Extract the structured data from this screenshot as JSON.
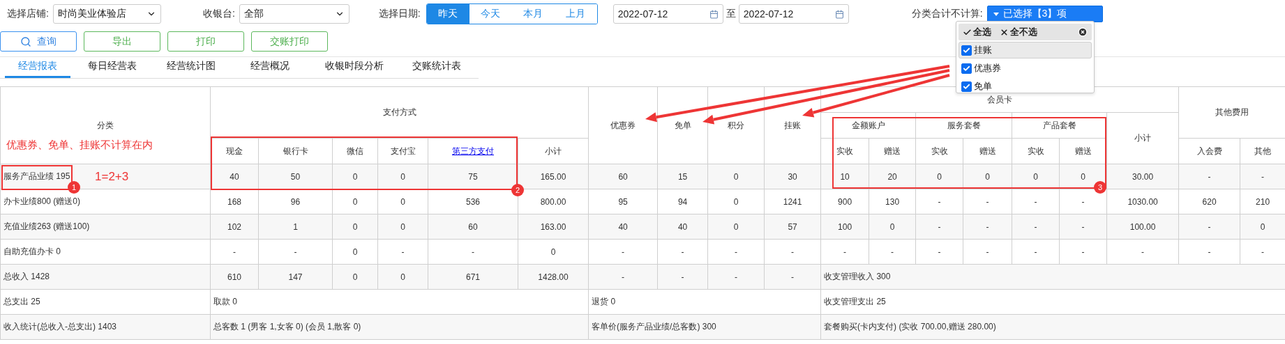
{
  "filters": {
    "store": {
      "label": "选择店铺:",
      "value": "时尚美业体验店"
    },
    "cashier": {
      "label": "收银台:",
      "value": "全部"
    },
    "date": {
      "label": "选择日期:",
      "options": [
        {
          "label": "昨天",
          "selected": true
        },
        {
          "label": "今天",
          "selected": false
        },
        {
          "label": "本月",
          "selected": false
        },
        {
          "label": "上月",
          "selected": false
        }
      ],
      "from": "2022-07-12",
      "separator": "至",
      "to": "2022-07-12"
    },
    "exclude": {
      "label": "分类合计不计算:",
      "value": "已选择【3】项"
    }
  },
  "buttons": [
    {
      "label": "查询",
      "kind": "search"
    },
    {
      "label": "导出",
      "kind": "plain"
    },
    {
      "label": "打印",
      "kind": "plain"
    },
    {
      "label": "交账打印",
      "kind": "plain"
    }
  ],
  "tabs": [
    {
      "label": "经营报表",
      "selected": true
    },
    {
      "label": "每日经营表",
      "selected": false
    },
    {
      "label": "经营统计图",
      "selected": false
    },
    {
      "label": "经营概况",
      "selected": false
    },
    {
      "label": "收银时段分析",
      "selected": false
    },
    {
      "label": "交账统计表",
      "selected": false
    }
  ],
  "exclude_menu": {
    "select_all": "全选",
    "select_none": "全不选",
    "items": [
      {
        "label": "挂账",
        "checked": true,
        "selected": true
      },
      {
        "label": "优惠券",
        "checked": true,
        "selected": false
      },
      {
        "label": "免单",
        "checked": true,
        "selected": false
      }
    ]
  },
  "table": {
    "columns": [
      {
        "label": "分类"
      },
      {
        "label": "支付方式",
        "children": [
          {
            "label": "现金"
          },
          {
            "label": "银行卡"
          },
          {
            "label": "微信"
          },
          {
            "label": "支付宝"
          },
          {
            "label": "第三方支付",
            "kind": "link"
          },
          {
            "label": "小计"
          }
        ]
      },
      {
        "label": "优惠券"
      },
      {
        "label": "免单"
      },
      {
        "label": "积分"
      },
      {
        "label": "挂账"
      },
      {
        "label": "会员卡",
        "children": [
          {
            "label": "金额账户",
            "children": [
              {
                "label": "实收"
              },
              {
                "label": "赠送"
              }
            ]
          },
          {
            "label": "服务套餐",
            "children": [
              {
                "label": "实收"
              },
              {
                "label": "赠送"
              }
            ]
          },
          {
            "label": "产品套餐",
            "children": [
              {
                "label": "实收"
              },
              {
                "label": "赠送"
              }
            ]
          },
          {
            "label": "小计"
          }
        ]
      },
      {
        "label": "其他费用",
        "children": [
          {
            "label": "入会费"
          },
          {
            "label": "其他"
          }
        ]
      }
    ],
    "rows": [
      {
        "kind": "data",
        "category": "服务产品业绩 195",
        "values": [
          "40",
          "50",
          "0",
          "0",
          "75",
          "165.00",
          "60",
          "15",
          "0",
          "30",
          "10",
          "20",
          "0",
          "0",
          "0",
          "0",
          "30.00",
          "-",
          "-"
        ]
      },
      {
        "kind": "data",
        "category": "办卡业绩800 (赠送0)",
        "values": [
          "168",
          "96",
          "0",
          "0",
          "536",
          "800.00",
          "95",
          "94",
          "0",
          "1241",
          "900",
          "130",
          "-",
          "-",
          "-",
          "-",
          "1030.00",
          "620",
          "210"
        ]
      },
      {
        "kind": "data",
        "category": "充值业绩263 (赠送100)",
        "values": [
          "102",
          "1",
          "0",
          "0",
          "60",
          "163.00",
          "40",
          "40",
          "0",
          "57",
          "100",
          "0",
          "-",
          "-",
          "-",
          "-",
          "100.00",
          "-",
          "0"
        ]
      },
      {
        "kind": "data",
        "category": "自助充值办卡 0",
        "values": [
          "-",
          "-",
          "0",
          "-",
          "-",
          "0",
          "-",
          "-",
          "-",
          "-",
          "-",
          "-",
          "-",
          "-",
          "-",
          "-",
          "-",
          "-",
          "-"
        ]
      },
      {
        "kind": "income",
        "category": "总收入 1428",
        "values": [
          "610",
          "147",
          "0",
          "0",
          "671",
          "1428.00",
          "-",
          "-",
          "-",
          "-"
        ],
        "note": "收支管理收入 300"
      },
      {
        "kind": "notes",
        "category": "总支出 25",
        "notes": [
          "取款 0",
          "退货 0",
          "收支管理支出 25"
        ]
      },
      {
        "kind": "notes",
        "category": "收入统计(总收入-总支出) 1403",
        "notes": [
          "总客数 1 (男客 1,女客 0) (会员 1,散客 0)",
          "客单价(服务产品业绩/总客数) 300",
          "套餐购买(卡内支付) (实收 700.00,赠送 280.00)"
        ]
      }
    ]
  },
  "annotations": {
    "note": "优惠券、免单、挂账不计算在内",
    "formula": "1=2+3",
    "markers": [
      "1",
      "2",
      "3"
    ]
  }
}
